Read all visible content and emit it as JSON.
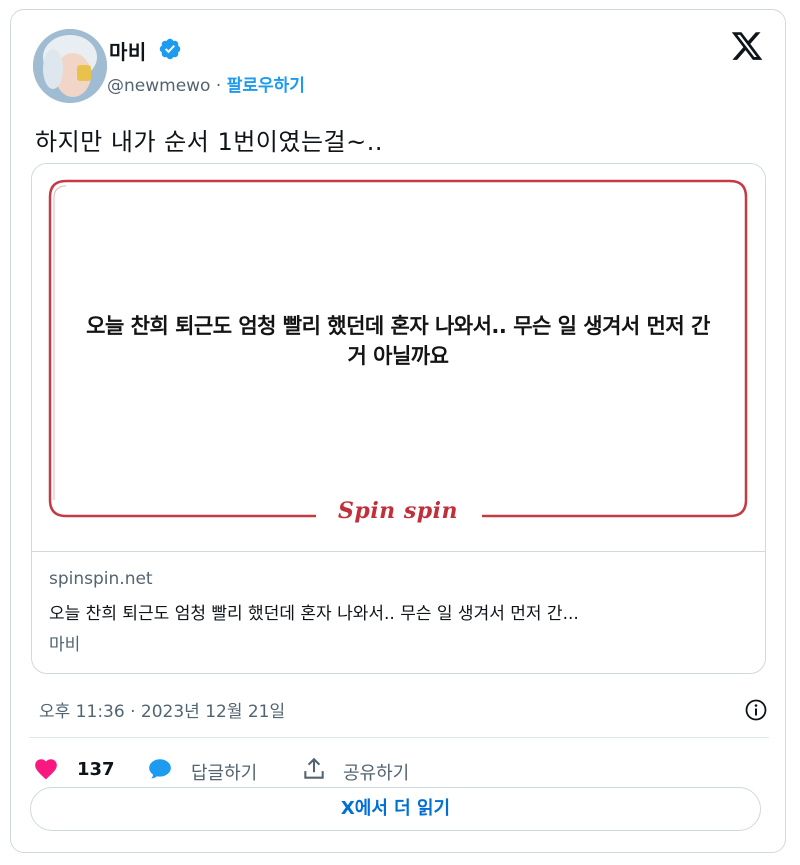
{
  "author": {
    "display_name": "마비",
    "handle": "@newmewo",
    "separator": "·",
    "follow_label": "팔로우하기",
    "avatar_icon": "avatar-photo",
    "verified_icon": "verified-badge-icon"
  },
  "tweet": {
    "text": "하지만 내가 순서 1번이였는걸~.."
  },
  "card": {
    "image_quote": "오늘 찬희 퇴근도 엄청 빨리 했던데 혼자 나와서.. 무슨 일 생겨서 먼저 간 거 아닐까요",
    "brand_logo": "Spinspin",
    "domain": "spinspin.net",
    "title": "오늘 찬희 퇴근도 엄청 빨리 했던데 혼자 나와서.. 무슨 일 생겨서 먼저 간...",
    "description": "마비",
    "frame_color": "#c63a44"
  },
  "meta": {
    "timestamp": "오후 11:36 · 2023년 12월 21일"
  },
  "actions": {
    "like_count": "137",
    "reply_label": "답글하기",
    "share_label": "공유하기"
  },
  "read_more": {
    "label": "X에서 더 읽기"
  },
  "colors": {
    "accent": "#1d9bf0",
    "like": "#f91880",
    "link": "#006fd6"
  }
}
